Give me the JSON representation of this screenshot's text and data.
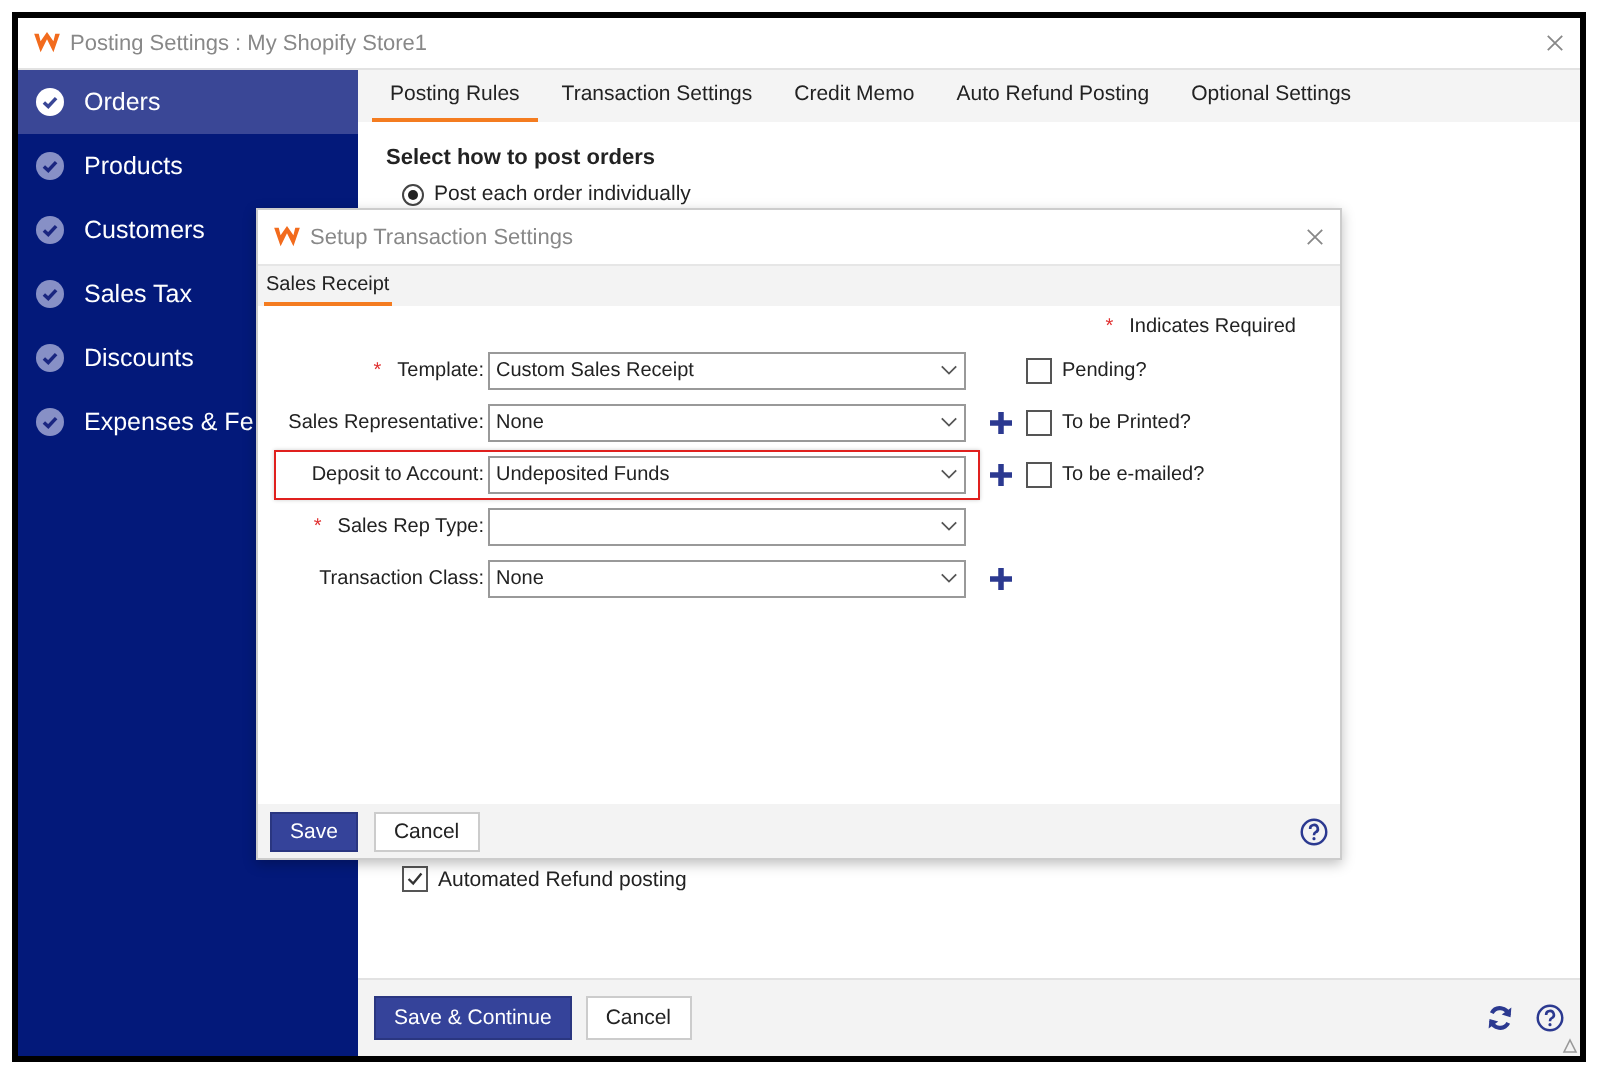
{
  "window": {
    "title": "Posting Settings : My Shopify Store1"
  },
  "sidebar": {
    "items": [
      {
        "label": "Orders",
        "selected": true
      },
      {
        "label": "Products",
        "selected": false
      },
      {
        "label": "Customers",
        "selected": false
      },
      {
        "label": "Sales Tax",
        "selected": false
      },
      {
        "label": "Discounts",
        "selected": false
      },
      {
        "label": "Expenses & Fe",
        "selected": false
      }
    ]
  },
  "tabs": [
    {
      "label": "Posting Rules",
      "selected": true
    },
    {
      "label": "Transaction Settings",
      "selected": false
    },
    {
      "label": "Credit Memo",
      "selected": false
    },
    {
      "label": "Auto Refund Posting",
      "selected": false
    },
    {
      "label": "Optional Settings",
      "selected": false
    }
  ],
  "content": {
    "heading": "Select how to post orders",
    "radio": {
      "label": "Post each order individually",
      "selected": true
    },
    "checkbox": {
      "label": "Automated Refund posting",
      "checked": true
    }
  },
  "footer": {
    "buttons": [
      {
        "label": "Save & Continue",
        "kind": "primary"
      },
      {
        "label": "Cancel",
        "kind": "secondary"
      }
    ]
  },
  "dialog": {
    "title": "Setup Transaction Settings",
    "tabs": [
      {
        "label": "Sales Receipt",
        "selected": true
      }
    ],
    "required_note": {
      "mark": "*",
      "text": "Indicates Required"
    },
    "fields": [
      {
        "label": "Template:",
        "value": "Custom Sales Receipt",
        "required": true,
        "addable": false,
        "highlighted": false,
        "checkbox": {
          "label": "Pending?",
          "checked": false
        }
      },
      {
        "label": "Sales Representative:",
        "value": "None",
        "required": false,
        "addable": true,
        "highlighted": false,
        "checkbox": {
          "label": "To be Printed?",
          "checked": false
        }
      },
      {
        "label": "Deposit to Account:",
        "value": "Undeposited Funds",
        "required": false,
        "addable": true,
        "highlighted": true,
        "checkbox": {
          "label": "To be e-mailed?",
          "checked": false
        }
      },
      {
        "label": "Sales Rep Type:",
        "required": true,
        "addable": false,
        "highlighted": false
      },
      {
        "label": "Transaction Class:",
        "value": "None",
        "required": false,
        "addable": true,
        "highlighted": false
      }
    ],
    "buttons": [
      {
        "label": "Save",
        "kind": "primary"
      },
      {
        "label": "Cancel",
        "kind": "secondary"
      }
    ]
  }
}
